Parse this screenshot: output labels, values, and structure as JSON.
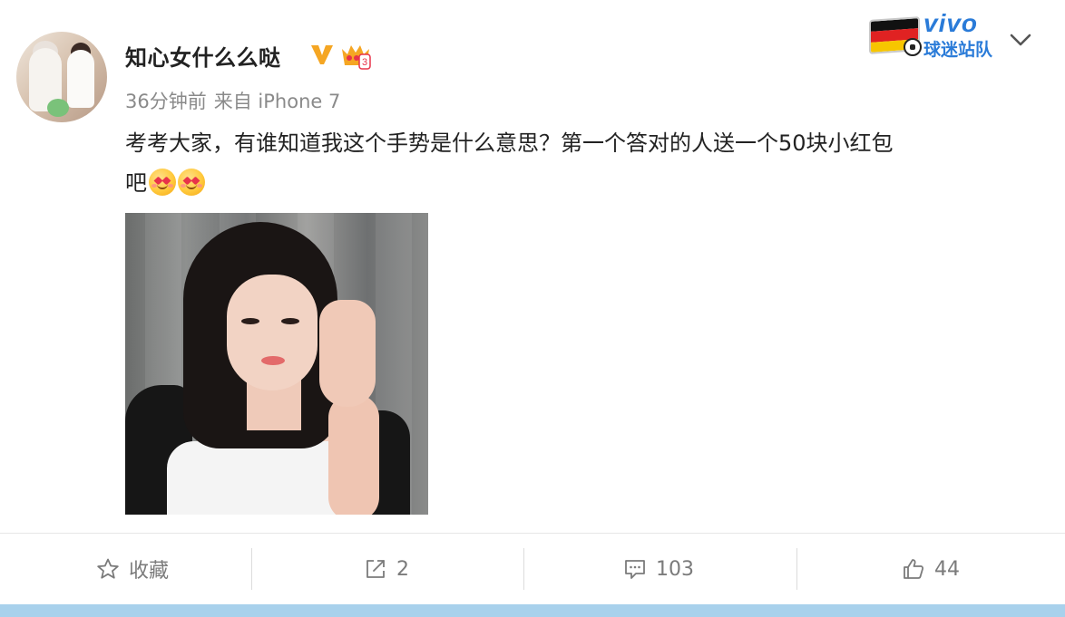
{
  "post": {
    "username": "知心女什么么哒",
    "meta": {
      "time": "36分钟前",
      "source_prefix": "来自",
      "device": "iPhone 7"
    },
    "text_line1": "考考大家，有谁知道我这个手势是什么意思？第一个答对的人送一个50块小红包",
    "text_line2": "吧",
    "emojis": [
      "heart-eyes-face-emoji",
      "heart-eyes-face-emoji"
    ],
    "badge_level": "3"
  },
  "brand": {
    "name": "vivo",
    "subtitle": "球迷站队",
    "flag": "germany-flag"
  },
  "actions": {
    "favorite_label": "收藏",
    "repost_count": "2",
    "comment_count": "103",
    "like_count": "44"
  },
  "colors": {
    "brand_blue": "#2a7bd8",
    "meta_gray": "#8a8a8a",
    "action_gray": "#7b7b7b",
    "vip_orange": "#f5a623",
    "bottom_bar": "#a8d1ec"
  }
}
